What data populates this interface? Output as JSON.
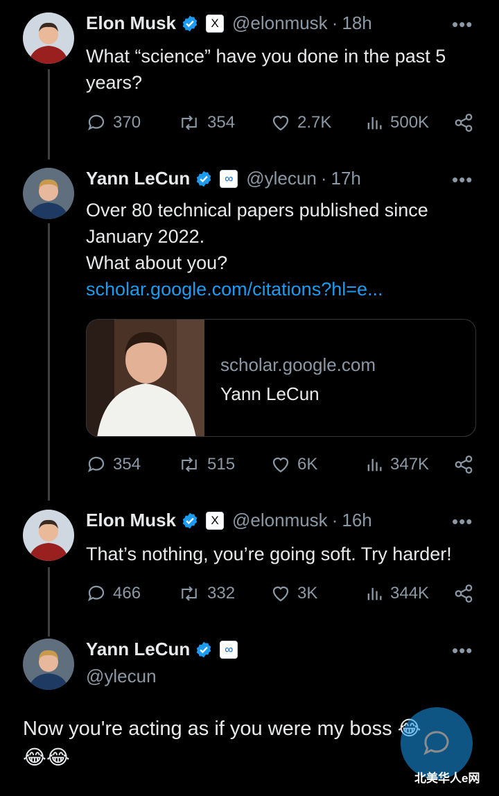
{
  "tweets": [
    {
      "name": "Elon Musk",
      "affiliate": "X",
      "handle": "@elonmusk",
      "separator": "·",
      "time": "18h",
      "more": "•••",
      "text_lines": [
        "What “science” have you done in the past 5",
        "years?"
      ],
      "stats": {
        "replies": "370",
        "retweets": "354",
        "likes": "2.7K",
        "views": "500K"
      }
    },
    {
      "name": "Yann LeCun",
      "affiliate": "∞",
      "handle": "@ylecun",
      "separator": "·",
      "time": "17h",
      "more": "•••",
      "text_lines": [
        "Over 80 technical papers published since",
        "January 2022.",
        "What about you?"
      ],
      "link": "scholar.google.com/citations?hl=e...",
      "card": {
        "domain": "scholar.google.com",
        "title": "Yann LeCun"
      },
      "stats": {
        "replies": "354",
        "retweets": "515",
        "likes": "6K",
        "views": "347K"
      }
    },
    {
      "name": "Elon Musk",
      "affiliate": "X",
      "handle": "@elonmusk",
      "separator": "·",
      "time": "16h",
      "more": "•••",
      "text_lines": [
        "That’s nothing, you’re going soft. Try harder!"
      ],
      "stats": {
        "replies": "466",
        "retweets": "332",
        "likes": "3K",
        "views": "344K"
      }
    },
    {
      "name": "Yann LeCun",
      "affiliate": "∞",
      "handle": "@ylecun",
      "more": "•••",
      "text_lines": [
        "Now you're acting as if you were my boss 😂",
        "😂😂"
      ]
    }
  ],
  "watermark": "北美华人e网",
  "colors": {
    "accent": "#1d9bf0",
    "muted": "#8b98a5",
    "text": "#e7e9ea",
    "background": "#000000"
  }
}
